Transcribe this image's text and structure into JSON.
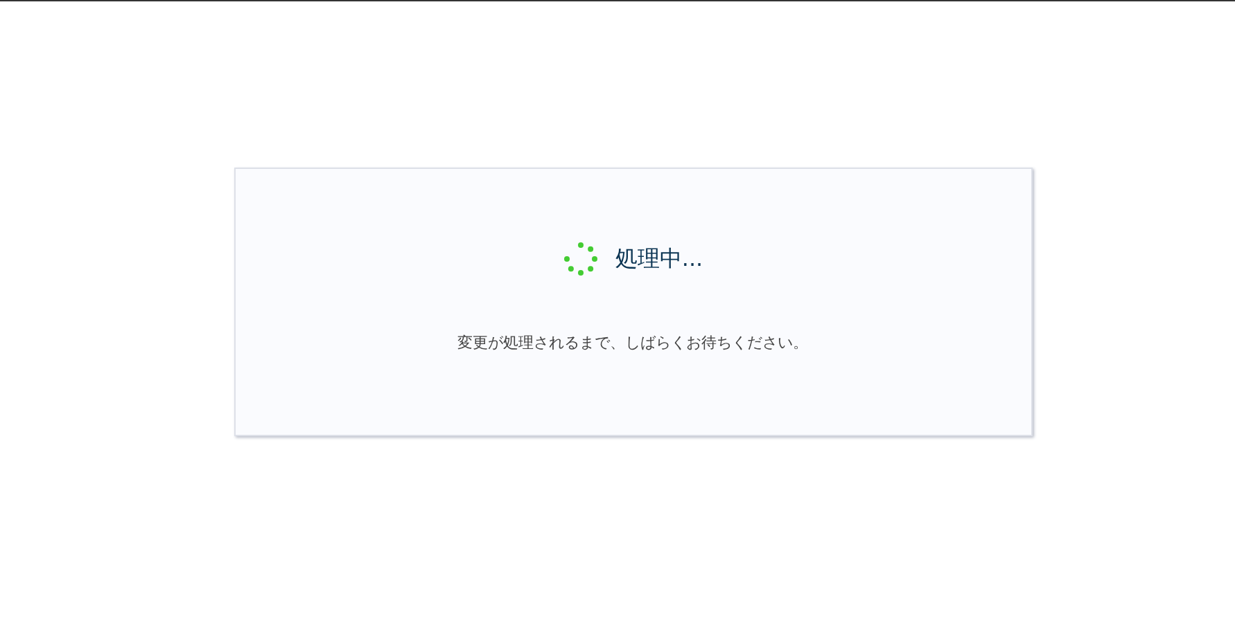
{
  "dialog": {
    "title": "処理中...",
    "message": "変更が処理されるまで、しばらくお待ちください。"
  }
}
